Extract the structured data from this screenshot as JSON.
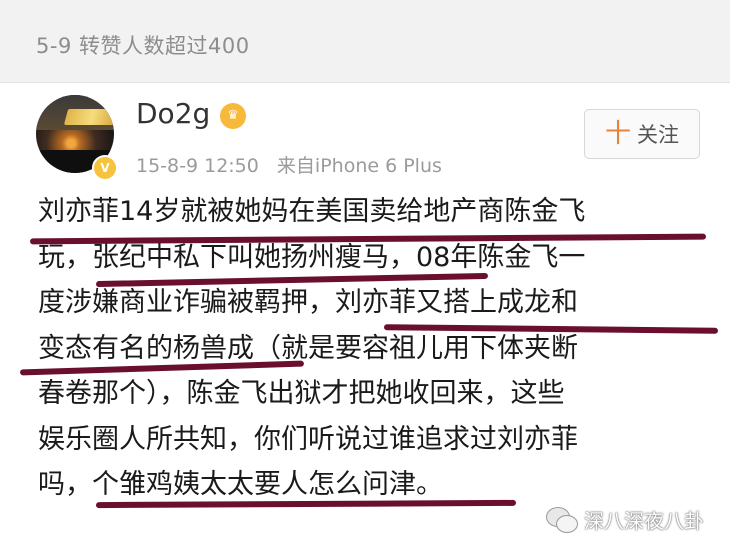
{
  "header": {
    "section_title": "5-9 转赞人数超过400"
  },
  "post": {
    "username": "Do2g",
    "crown_symbol": "♛",
    "verified_symbol": "V",
    "date": "15-8-9 12:50",
    "source": "来自iPhone 6 Plus",
    "follow_plus": "十",
    "follow_label": "关注",
    "lines": [
      "刘亦菲14岁就被她妈在美国卖给地产商陈金飞",
      "玩，张纪中私下叫她扬州瘦马，08年陈金飞一",
      "度涉嫌商业诈骗被羁押，刘亦菲又搭上成龙和",
      "变态有名的杨兽成（就是要容祖儿用下体夹断",
      "春卷那个），陈金飞出狱才把她收回来，这些",
      "娱乐圈人所共知，你们听说过谁追求过刘亦菲",
      "吗，个雏鸡姨太太要人怎么问津。"
    ]
  },
  "watermark": {
    "text": "深八深夜八卦"
  },
  "colors": {
    "underline": "#6a0f2e",
    "accent": "#e8823b"
  }
}
